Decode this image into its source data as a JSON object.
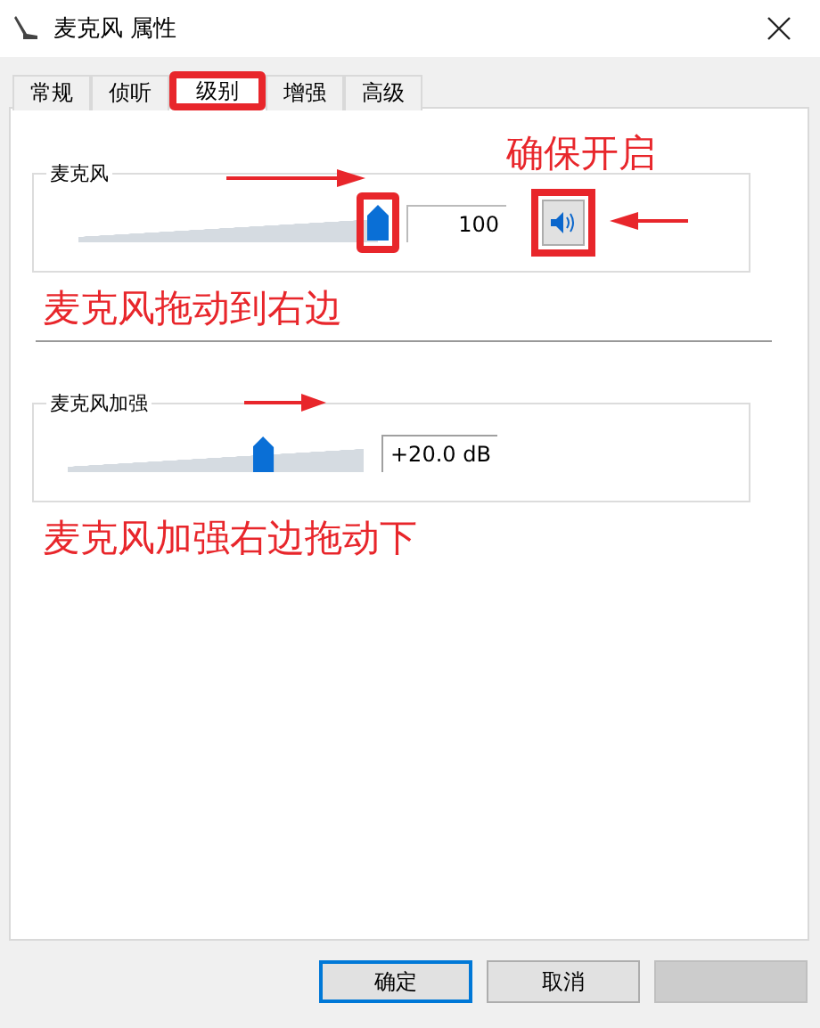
{
  "window": {
    "title": "麦克风 属性"
  },
  "tabs": [
    {
      "label": "常规",
      "selected": false
    },
    {
      "label": "侦听",
      "selected": false
    },
    {
      "label": "级别",
      "selected": true
    },
    {
      "label": "增强",
      "selected": false
    },
    {
      "label": "高级",
      "selected": false
    }
  ],
  "groups": [
    {
      "label": "麦克风",
      "reading": "100",
      "kind": "volume",
      "muted": false
    },
    {
      "label": "麦克风加强",
      "reading": "+20.0 dB",
      "kind": "boost"
    }
  ],
  "annotations": [
    "确保开启",
    "麦克风拖动到右边",
    "麦克风加强右边拖动下"
  ],
  "buttons": [
    {
      "label": "确定",
      "default": true
    },
    {
      "label": "取消",
      "default": false
    }
  ]
}
